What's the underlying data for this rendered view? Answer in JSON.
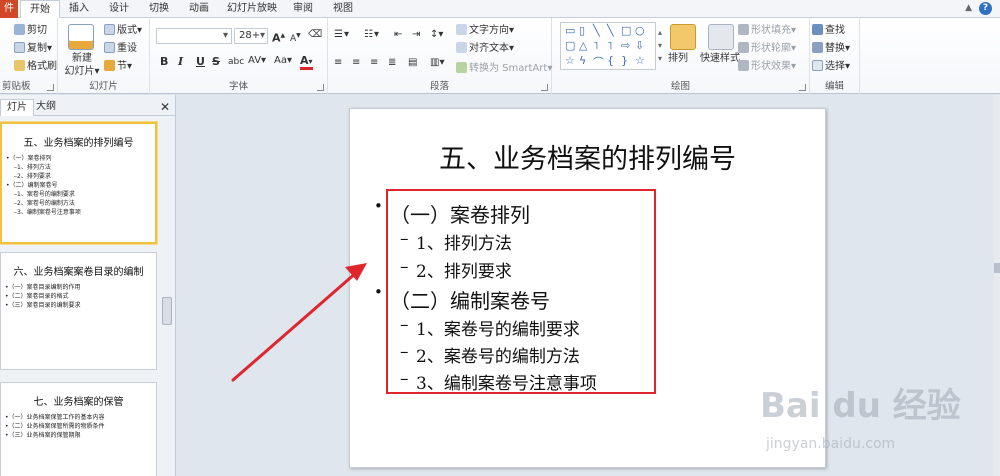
{
  "ribbon_tabs": {
    "file": "件",
    "home": "开始",
    "insert": "插入",
    "design": "设计",
    "transitions": "切换",
    "animations": "动画",
    "slideshow": "幻灯片放映",
    "review": "审阅",
    "view": "视图"
  },
  "clipboard": {
    "cut": "剪切",
    "copy": "复制",
    "format_painter": "格式刷",
    "label": "剪贴板"
  },
  "slides_group": {
    "new_slide_line1": "新建",
    "new_slide_line2": "幻灯片",
    "layout": "版式",
    "reset": "重设",
    "section": "节",
    "label": "幻灯片"
  },
  "font_group": {
    "font_size": "28+",
    "grow": "A",
    "shrink": "A",
    "bold": "B",
    "italic": "I",
    "underline": "U",
    "strike": "S",
    "shadow": "abc",
    "spacing": "AV",
    "case": "Aa",
    "color": "A",
    "label": "字体"
  },
  "paragraph_group": {
    "text_direction": "文字方向",
    "align_text": "对齐文本",
    "convert_smartart": "转换为 SmartArt",
    "label": "段落"
  },
  "drawing_group": {
    "arrange": "排列",
    "quick_styles": "快速样式",
    "shape_fill": "形状填充",
    "shape_outline": "形状轮廓",
    "shape_effects": "形状效果",
    "label": "绘图"
  },
  "editing_group": {
    "find": "查找",
    "replace": "替换",
    "select": "选择",
    "label": "编辑"
  },
  "left_pane": {
    "tab_slides": "灯片",
    "tab_outline": "大纲",
    "close": "✕"
  },
  "thumbnails": [
    {
      "title": "五、业务档案的排列编号",
      "bullets": [
        "•（一）案卷排列",
        "–1、排列方法",
        "–2、排列要求",
        "•（二）编制案卷号",
        "–1、案卷号的编制要求",
        "–2、案卷号的编制方法",
        "–3、编制案卷号注意事项"
      ]
    },
    {
      "title": "六、业务档案案卷目录的编制",
      "bullets": [
        "•（一）案卷目录编制的作用",
        "•（二）案卷目录的格式",
        "•（三）案卷目录的编制要求"
      ]
    },
    {
      "title": "七、业务档案的保管",
      "bullets": [
        "•（一）业务档案保管工作的基本内容",
        "•（二）业务档案保管所需的物质条件",
        "•（三）业务档案的保管期限"
      ]
    }
  ],
  "slide": {
    "title": "五、业务档案的排列编号",
    "bullets": [
      {
        "marker": "•",
        "text": "（一）案卷排列"
      },
      {
        "marker": "–",
        "text": "1、排列方法"
      },
      {
        "marker": "–",
        "text": "2、排列要求"
      },
      {
        "marker": "•",
        "text": "（二）编制案卷号"
      },
      {
        "marker": "–",
        "text": "1、案卷号的编制要求"
      },
      {
        "marker": "–",
        "text": "2、案卷号的编制方法"
      },
      {
        "marker": "–",
        "text": "3、编制案卷号注意事项"
      }
    ]
  },
  "watermark": {
    "brand": "Bai du 经验",
    "url": "jingyan.baidu.com"
  },
  "colors": {
    "file_tab": "#d24726",
    "highlight_box": "#e0262c",
    "arrow": "#e0262c",
    "selected_thumb": "#f0c040"
  }
}
